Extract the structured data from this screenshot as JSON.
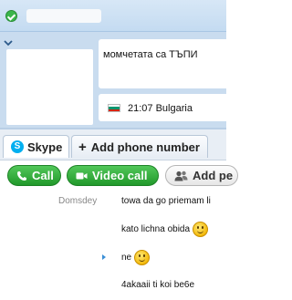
{
  "profile": {
    "mood_message": "момчетата са ТЪПИ",
    "local_time": "21:07",
    "country": "Bulgaria",
    "flag_colors": [
      "#ffffff",
      "#00966e",
      "#d62612"
    ]
  },
  "tabs": {
    "skype_label": "Skype",
    "add_phone_label": "Add phone number"
  },
  "actions": {
    "call_label": "Call",
    "video_call_label": "Video call",
    "add_people_label": "Add pe"
  },
  "colors": {
    "accent_green": "#3ab54a",
    "skype_blue": "#00aff0",
    "header_blue": "#c9dcef"
  },
  "chat": {
    "messages": [
      {
        "sender": "Domsdey",
        "text": "towa da go priemam li"
      },
      {
        "sender": "",
        "text": "kato lichna obida",
        "emoticon": "smile-icon"
      },
      {
        "sender": "",
        "text": "ne",
        "emoticon": "smile-icon"
      },
      {
        "sender": "",
        "text": "4akaaii ti koi be6e"
      }
    ]
  }
}
